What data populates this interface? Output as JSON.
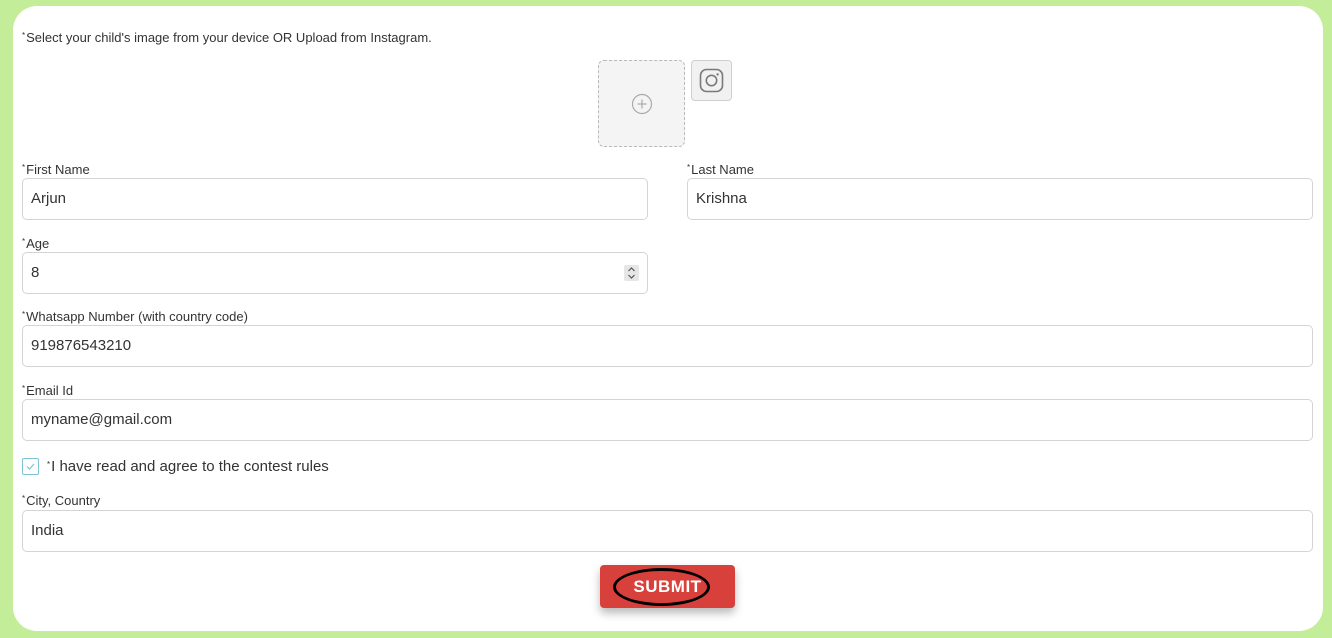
{
  "upload": {
    "instruction": "Select your child's image from your device OR Upload from Instagram.",
    "required_mark": "*"
  },
  "icons": {
    "add": "plus-circle-icon",
    "instagram": "instagram-icon",
    "check": "check-icon"
  },
  "form": {
    "first_name": {
      "label": "First Name",
      "value": "Arjun"
    },
    "last_name": {
      "label": "Last Name",
      "value": "Krishna"
    },
    "age": {
      "label": "Age",
      "value": "8"
    },
    "whatsapp": {
      "label": "Whatsapp Number (with country code)",
      "value": "919876543210"
    },
    "email": {
      "label": "Email Id",
      "value": "myname@gmail.com"
    },
    "agree": {
      "label": "I have read and agree to the contest rules",
      "checked": true
    },
    "city": {
      "label": "City, Country",
      "value": "India"
    }
  },
  "submit": {
    "label": "SUBMIT"
  },
  "colors": {
    "background": "#c4ed9a",
    "submit": "#d8403b",
    "checkbox_accent": "#7cc4d6"
  }
}
